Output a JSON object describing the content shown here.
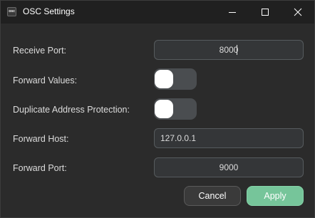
{
  "window": {
    "title": "OSC Settings",
    "app_icon_text": "osc"
  },
  "form": {
    "receive_port": {
      "label": "Receive Port:",
      "value": "8000"
    },
    "forward_values": {
      "label": "Forward Values:",
      "checked": false
    },
    "duplicate_protection": {
      "label": "Duplicate Address Protection:",
      "checked": false
    },
    "forward_host": {
      "label": "Forward Host:",
      "value": "127.0.0.1"
    },
    "forward_port": {
      "label": "Forward Port:",
      "value": "9000"
    }
  },
  "buttons": {
    "cancel_label": "Cancel",
    "apply_label": "Apply"
  },
  "colors": {
    "accent": "#76c59a",
    "window_bg": "#2b2b2b",
    "titlebar_bg": "#202020",
    "input_bg": "#343638",
    "switch_off": "#4a4d50"
  },
  "icons": {
    "minimize": "minimize-icon",
    "maximize": "maximize-icon",
    "close": "close-icon"
  }
}
